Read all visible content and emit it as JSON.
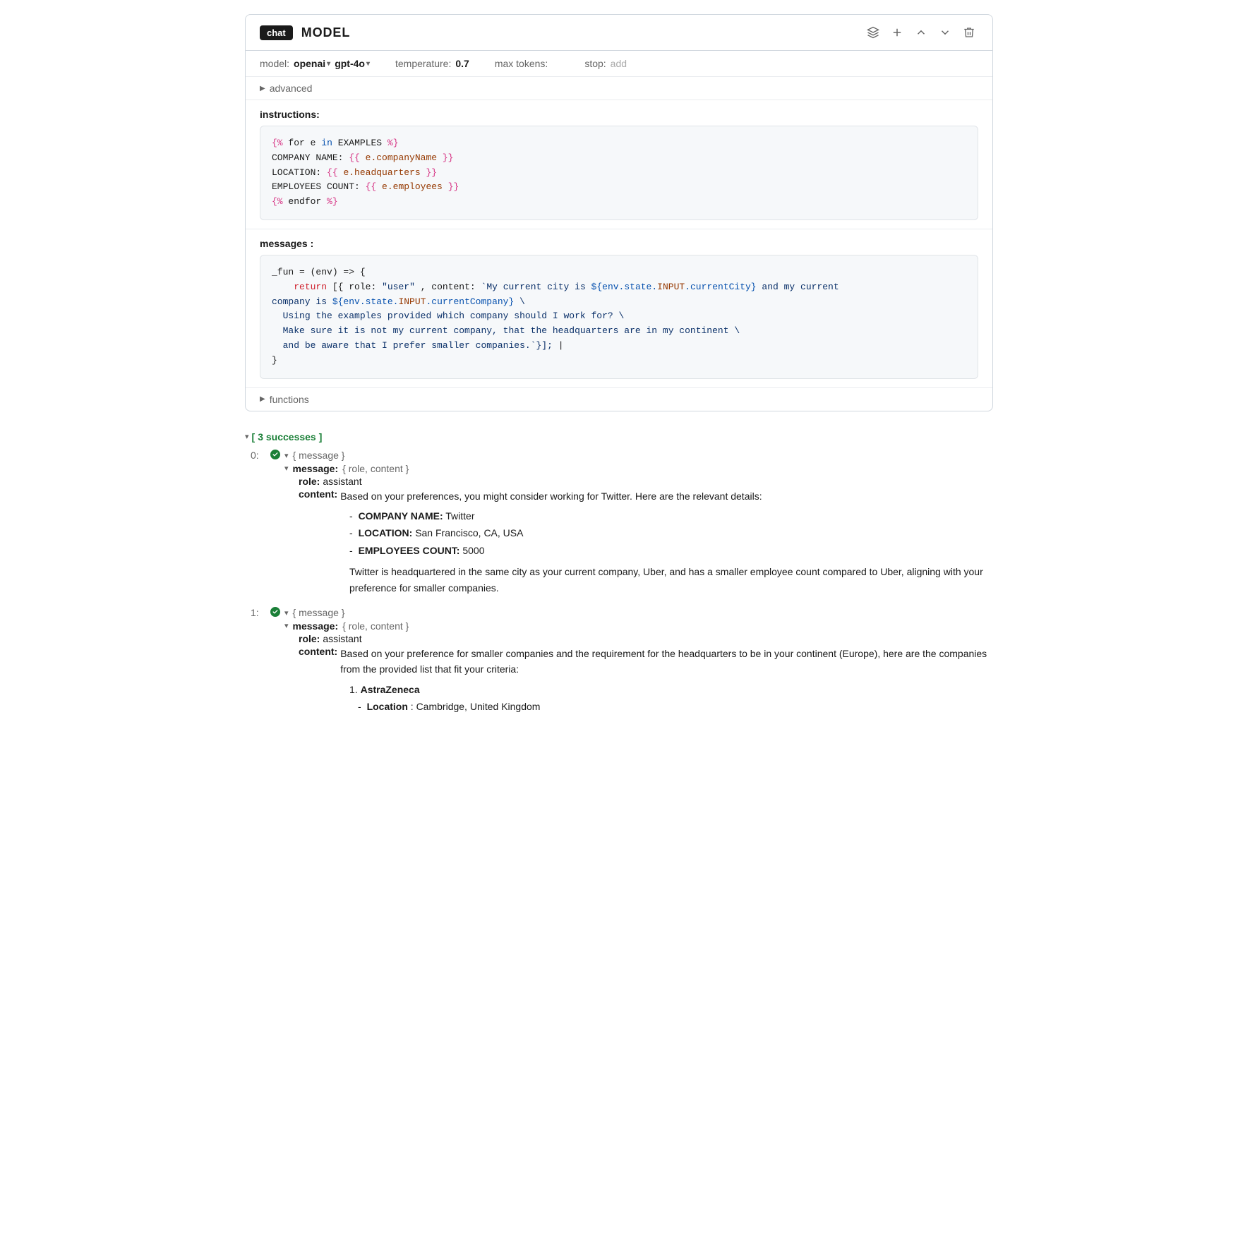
{
  "header": {
    "badge": "chat",
    "title": "MODEL",
    "icons": [
      "layers-icon",
      "plus-icon",
      "chevron-up-icon",
      "chevron-down-icon",
      "trash-icon"
    ]
  },
  "params": {
    "model_label": "model:",
    "provider": "openai",
    "model_name": "gpt-4o",
    "temperature_label": "temperature:",
    "temperature_value": "0.7",
    "max_tokens_label": "max tokens:",
    "stop_label": "stop:",
    "stop_placeholder": "add"
  },
  "advanced": {
    "label": "advanced"
  },
  "instructions": {
    "label": "instructions:",
    "code_lines": [
      {
        "text": "{% for e in EXAMPLES %}",
        "type": "template"
      },
      {
        "text": "COMPANY NAME:  {{e.companyName}}",
        "type": "plain"
      },
      {
        "text": "LOCATION:  {{e.headquarters}}",
        "type": "plain"
      },
      {
        "text": "EMPLOYEES COUNT:  {{e.employees}}",
        "type": "plain"
      },
      {
        "text": "{% endfor %}",
        "type": "template"
      }
    ]
  },
  "messages": {
    "label": "messages :",
    "code_lines": [
      {
        "text": "_fun = (env) => {",
        "type": "js"
      },
      {
        "text": "  return [{ role: \"user\", content: `My current city is ${env.state.INPUT.currentCity} and my current",
        "type": "js"
      },
      {
        "text": "company is ${env.state.INPUT.currentCompany} \\",
        "type": "js"
      },
      {
        "text": "  Using the examples provided which company should I work for? \\",
        "type": "js"
      },
      {
        "text": "  Make sure it is not my current company, that the headquarters are in my continent \\",
        "type": "js"
      },
      {
        "text": "  and be aware that I prefer smaller companies.`}];|",
        "type": "js"
      },
      {
        "text": "}",
        "type": "js"
      }
    ]
  },
  "functions": {
    "label": "functions"
  },
  "results": {
    "successes_label": "3 successes",
    "items": [
      {
        "index": "0:",
        "message_label": "{ message }",
        "message_sub_label": "{ role, content }",
        "role_label": "role:",
        "role_value": "assistant",
        "content_label": "content:",
        "content_text": "Based on your preferences, you might consider working for Twitter. Here are the relevant details:",
        "bullets": [
          "- **COMPANY NAME:** Twitter",
          "- **LOCATION:** San Francisco, CA, USA",
          "- **EMPLOYEES COUNT:** 5000"
        ],
        "paragraph": "Twitter is headquartered in the same city as your current company, Uber, and has a smaller employee count compared to Uber, aligning with your preference for smaller companies."
      },
      {
        "index": "1:",
        "message_label": "{ message }",
        "message_sub_label": "{ role, content }",
        "role_label": "role:",
        "role_value": "assistant",
        "content_label": "content:",
        "content_text": "Based on your preference for smaller companies and the requirement for the headquarters to be in your continent (Europe), here are the companies from the provided list that fit your criteria:",
        "bullets": [
          "1. **AstraZeneca**",
          "   - **Location**: Cambridge, United Kingdom"
        ],
        "paragraph": ""
      }
    ]
  }
}
